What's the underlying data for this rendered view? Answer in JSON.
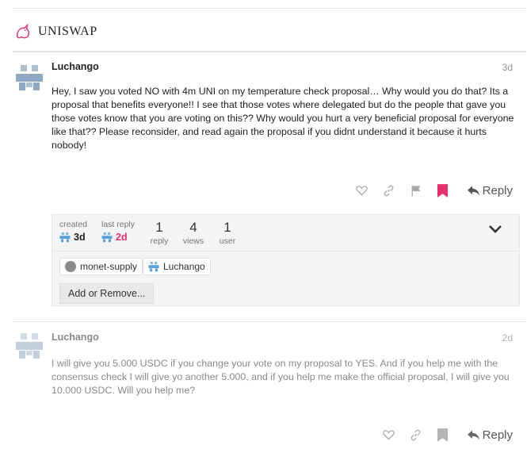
{
  "site": {
    "brand": "UNISWAP",
    "logo_icon": "unicorn-icon",
    "accent": "#ff007a"
  },
  "posts": [
    {
      "author": "Luchango",
      "age": "3d",
      "body": "Hey, I saw you voted NO with 4m UNI on my temperature check proposal… Why would you do that? Its a proposal that benefits everyone!! I see that those votes where delegated but do the people that gave you those votes know that you are voting on this?? Why would you hurt a very beneficial proposal for everyone like that?? Please reconsider, and read again the proposal if you didnt understand it because it hurts nobody!",
      "reply_label": "Reply",
      "bookmarked": true
    },
    {
      "author": "Luchango",
      "age": "2d",
      "body": "I will give you 5.000 USDC if you change your vote on my proposal to YES. And if you help me with the consensus check I will give yo another 5.000, and if you help me make the official proposal, I will give you 10.000 USDC. Will you help me?",
      "reply_label": "Reply",
      "bookmarked": false
    }
  ],
  "topic_map": {
    "created_label": "created",
    "created_value": "3d",
    "last_reply_label": "last reply",
    "last_reply_value": "2d",
    "stats": [
      {
        "num": "1",
        "label": "reply"
      },
      {
        "num": "4",
        "label": "views"
      },
      {
        "num": "1",
        "label": "user"
      }
    ],
    "participants": [
      "monet-supply",
      "Luchango"
    ],
    "add_remove_label": "Add or Remove..."
  }
}
